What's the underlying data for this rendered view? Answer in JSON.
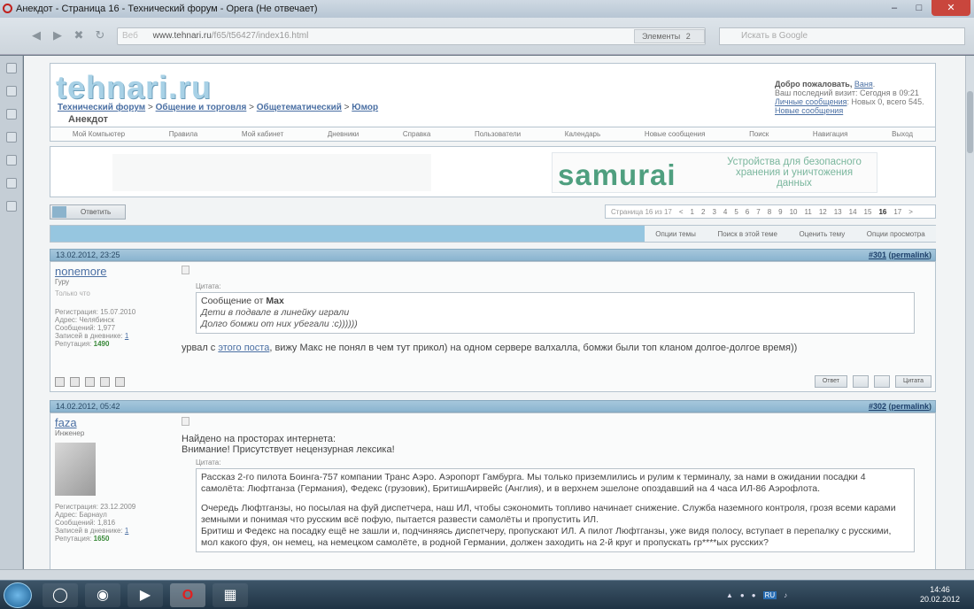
{
  "window": {
    "title": "Анекдот - Страница 16 - Технический форум - Opera (Не отвечает)"
  },
  "browser": {
    "address_prefix": "Веб",
    "address_host": "www.tehnari.ru",
    "address_path": "/f65/t56427/index16.html",
    "elements_label": "Элементы",
    "elements_count": "2",
    "search_placeholder": "Искать в Google"
  },
  "forum": {
    "logo": "tehnari.ru",
    "breadcrumb": [
      "Технический форум",
      "Общение и торговля",
      "Общетематический",
      "Юмор"
    ],
    "current_thread": "Анекдот",
    "welcome": {
      "greeting": "Добро пожаловать,",
      "user": "Ваня",
      "last_visit": "Ваш последний визит: Сегодня в",
      "last_visit_time": "09:21",
      "pm_link": "Личные сообщения",
      "pm_stats": ": Новых 0, всего 545.",
      "new_posts": "Новые сообщения"
    },
    "nav": [
      "Мой Компьютер",
      "Правила",
      "Мой кабинет",
      "Дневники",
      "Справка",
      "Пользователи",
      "Календарь",
      "Новые сообщения",
      "Поиск",
      "Навигация",
      "Выход"
    ],
    "ad": {
      "brand": "samurai",
      "tagline": "Устройства для безопасного хранения и уничтожения данных"
    },
    "reply_button": "Ответить",
    "pager": {
      "label": "Страница 16 из 17",
      "prev": "<",
      "pages": [
        "1",
        "2",
        "3",
        "4",
        "5",
        "6",
        "7",
        "8",
        "9",
        "10",
        "11",
        "12",
        "13",
        "14",
        "15",
        "16",
        "17"
      ],
      "current": "16",
      "next": ">"
    },
    "thread_tools": [
      "Опции темы",
      "Поиск в этой теме",
      "Оценить тему",
      "Опции просмотра"
    ],
    "posts": [
      {
        "date": "13.02.2012, 23:25",
        "number": "#301",
        "permalink": "permalink",
        "username": "nonemore",
        "rank": "Гуру",
        "status": "Только что",
        "reg": "Регистрация: 15.07.2010",
        "address": "Адрес: Челябинск",
        "messages": "Сообщений: 1,977",
        "diary": "Записей в дневнике:",
        "diary_count": "1",
        "reputation": "Репутация:",
        "rep_value": "1490",
        "quote_label": "Цитата:",
        "quote_author_prefix": "Сообщение от",
        "quote_author": "Max",
        "quote_lines": [
          "Дети в подвале в линейку играли",
          "Долго бомжи от них убегали :c))))))"
        ],
        "text_before": "урвал с",
        "text_link": "этого поста",
        "text_after": ", вижу Макс не понял в чем тут прикол) на одном сервере валхалла, бомжи были топ кланом долгое-долгое время))",
        "btn_reply": "Ответ",
        "btn_quote": "Цитата"
      },
      {
        "date": "14.02.2012, 05:42",
        "number": "#302",
        "permalink": "permalink",
        "username": "faza",
        "rank": "Инженер",
        "reg": "Регистрация: 23.12.2009",
        "address": "Адрес: Барнаул",
        "messages": "Сообщений: 1,816",
        "diary": "Записей в дневнике:",
        "diary_count": "1",
        "reputation": "Репутация:",
        "rep_value": "1650",
        "intro1": "Найдено на просторах интернета:",
        "intro2": "Внимание! Присутствует нецензурная лексика!",
        "quote_label": "Цитата:",
        "quote_p1": "Рассказ 2-го пилота Боинга-757 компании Транс Аэро. Аэропорт Гамбурга. Мы только приземлились и рулим к терминалу, за нами в ожидании посадки 4 самолёта: Люфтганза (Германия), Федекс (грузовик), БритишАирвейс (Англия), и в верхнем эшелоне опоздавший на 4 часа ИЛ-86 Аэрофлота.",
        "quote_p2": "Очередь Люфтганзы, но посылая на фуй диспетчера, наш ИЛ, чтобы сэкономить топливо начинает снижение. Служба наземного контроля, грозя всеми карами земными и понимая что русским всё пофую, пытается развести самолёты и пропустить ИЛ.",
        "quote_p3": "Бритиш и Федекс на посадку ещё не зашли и, подчиняясь диспетчеру, пропускают ИЛ. А пилот Люфтганзы, уже видя полосу, вступает в перепалку с русскими, мол какого фуя, он немец, на немецком самолёте, в родной Германии, должен заходить на 2-й круг и пропускать гр****ых русских?"
      }
    ]
  },
  "taskbar": {
    "time": "14:46",
    "date": "20.02.2012",
    "lang": "RU"
  }
}
